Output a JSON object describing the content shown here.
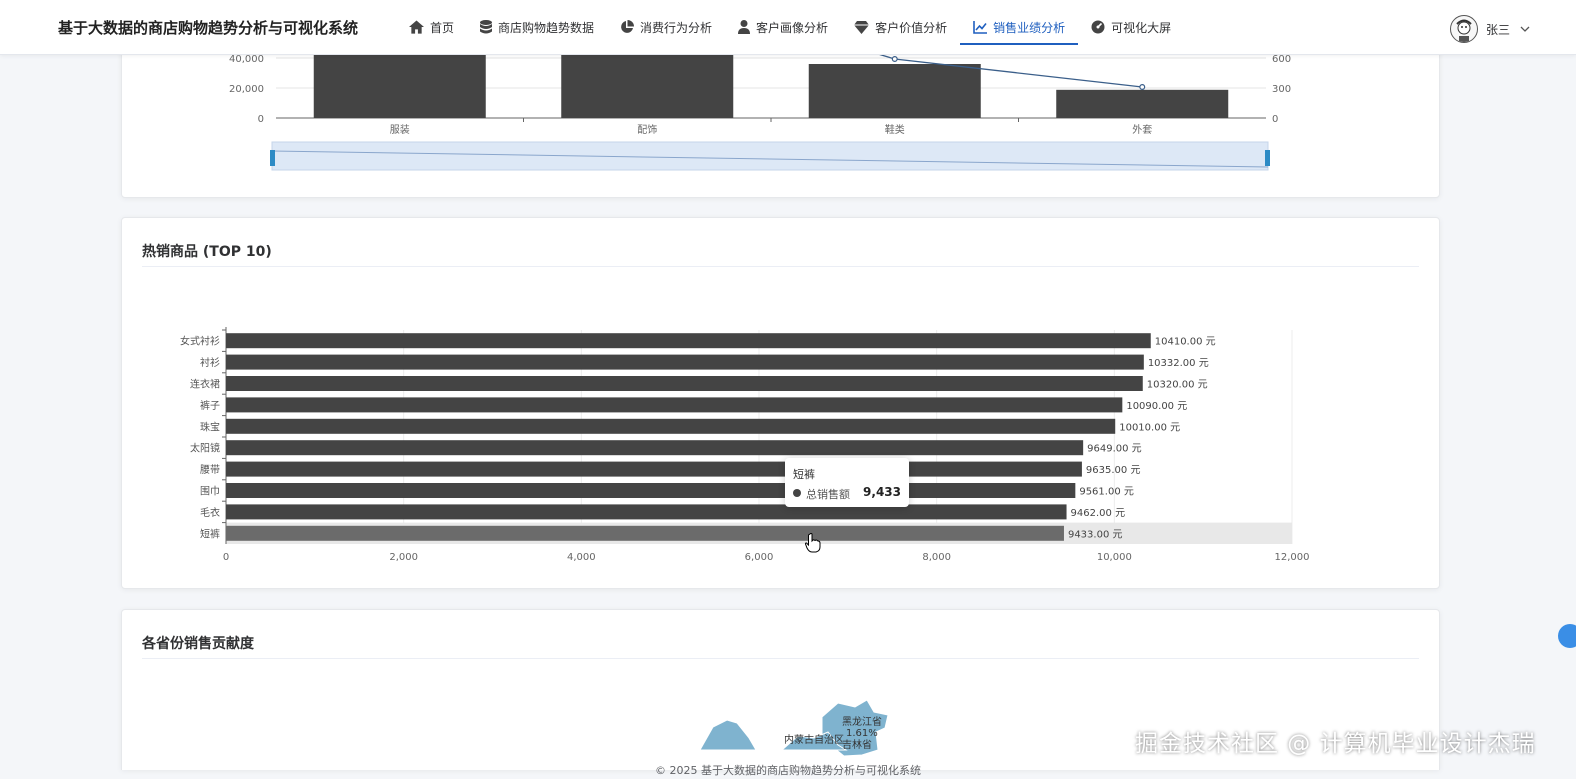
{
  "app": {
    "title": "基于大数据的商店购物趋势分析与可视化系统"
  },
  "nav": {
    "items": [
      {
        "label": "首页",
        "icon": "home-icon"
      },
      {
        "label": "商店购物趋势数据",
        "icon": "database-icon"
      },
      {
        "label": "消费行为分析",
        "icon": "pie-icon"
      },
      {
        "label": "客户画像分析",
        "icon": "user-icon"
      },
      {
        "label": "客户价值分析",
        "icon": "diamond-icon"
      },
      {
        "label": "销售业绩分析",
        "icon": "line-chart-icon",
        "active": true
      },
      {
        "label": "可视化大屏",
        "icon": "dashboard-icon"
      }
    ]
  },
  "user": {
    "name": "张三"
  },
  "chart_data": [
    {
      "type": "bar",
      "categories": [
        "服装",
        "配饰",
        "鞋类",
        "外套"
      ],
      "series": [
        {
          "kind": "bar",
          "values": [
            null,
            null,
            36000,
            18800
          ]
        },
        {
          "kind": "line",
          "values": [
            null,
            null,
            590,
            310
          ]
        }
      ],
      "y_ticks": [
        "0",
        "20,000",
        "40,000"
      ],
      "y2_ticks": [
        "0",
        "300",
        "600"
      ],
      "dataZoom": true
    },
    {
      "type": "bar",
      "title": "热销商品 (TOP 10)",
      "orientation": "horizontal",
      "categories": [
        "女式衬衫",
        "衬衫",
        "连衣裙",
        "裤子",
        "珠宝",
        "太阳镜",
        "腰带",
        "围巾",
        "毛衣",
        "短裤"
      ],
      "values": [
        10410,
        10332,
        10320,
        10090,
        10010,
        9649,
        9635,
        9561,
        9462,
        9433
      ],
      "value_labels": [
        "10410.00 元",
        "10332.00 元",
        "10320.00 元",
        "10090.00 元",
        "10010.00 元",
        "9649.00 元",
        "9635.00 元",
        "9561.00 元",
        "9462.00 元",
        "9433.00 元"
      ],
      "xlim": [
        0,
        12000
      ],
      "x_ticks": [
        "0",
        "2,000",
        "4,000",
        "6,000",
        "8,000",
        "10,000",
        "12,000"
      ],
      "series_name": "总销售额",
      "bar_color": "#444444",
      "highlight_color": "#6b6b6b",
      "tooltip": {
        "name": "短裤",
        "series": "总销售额",
        "value": "9,433"
      }
    }
  ],
  "map_card": {
    "title": "各省份销售贡献度",
    "labels": [
      "黑龙江省",
      "1.61%",
      "内蒙古自治区",
      "吉林省"
    ],
    "fill_color": "#7fb3cf"
  },
  "footer": "© 2025 基于大数据的商店购物趋势分析与可视化系统",
  "watermark": "掘金技术社区 @ 计算机毕业设计杰瑞"
}
